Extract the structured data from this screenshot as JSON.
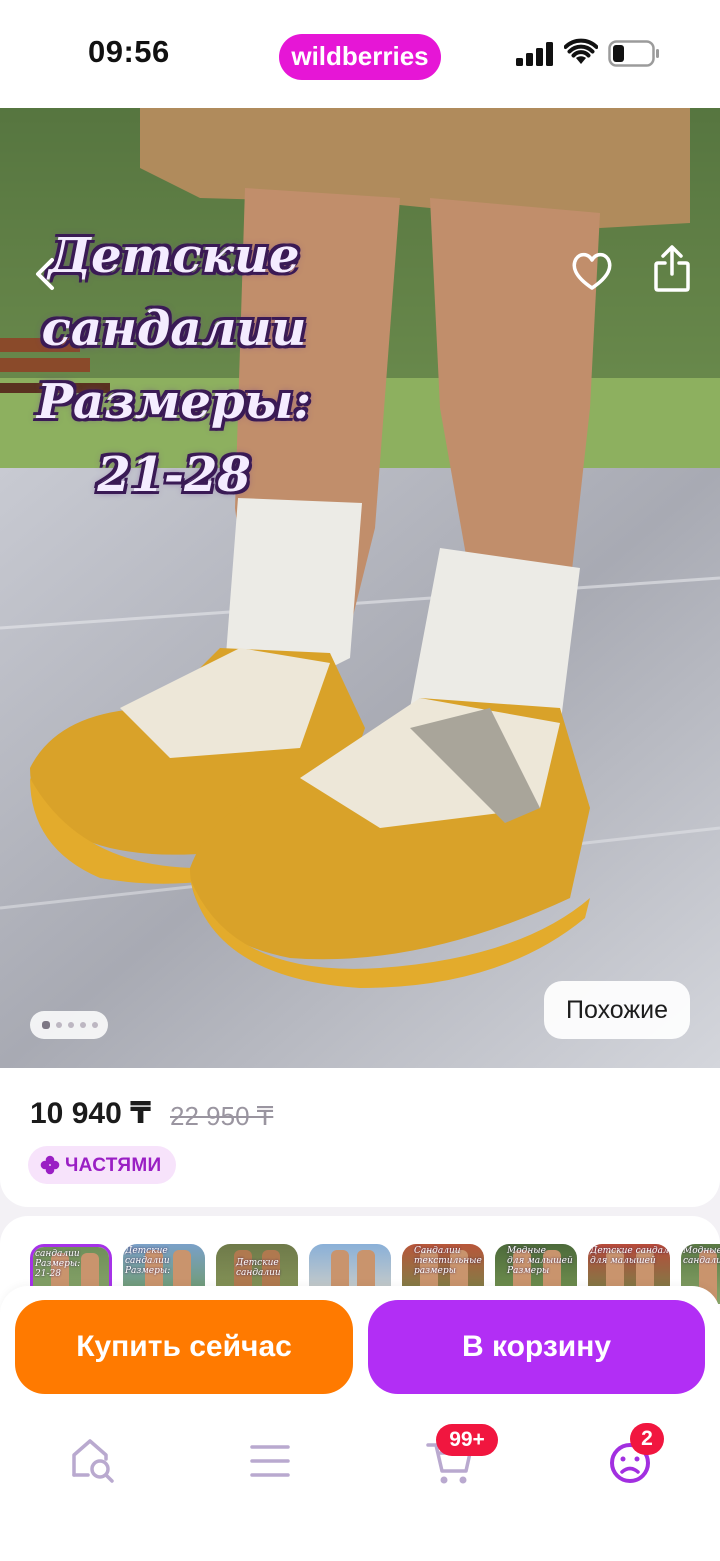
{
  "status_bar": {
    "time": "09:56",
    "brand": "wildberries",
    "icons": [
      "cellular-signal-icon",
      "wifi-icon",
      "battery-icon"
    ]
  },
  "product": {
    "image_caption_lines": [
      "Детские",
      "сандалии",
      "Размеры:",
      "21-28"
    ],
    "image_count": 5,
    "active_image": 1,
    "similar_label": "Похожие",
    "price_current": "10 940 ₸",
    "price_old": "22 950 ₸",
    "installments_label": "ЧАСТЯМИ"
  },
  "thumbnails": [
    {
      "caption": "сандалии\nРазмеры:\n21-28"
    },
    {
      "caption": "Детские\nсандалии\nРазмеры:"
    },
    {
      "caption": "Детские\nсандалии"
    },
    {
      "caption": ""
    },
    {
      "caption": "Сандалии\nтекстильные\nразмеры"
    },
    {
      "caption": "Модные\nдля малышей\nРазмеры"
    },
    {
      "caption": "Детские сандалии\nдля малышей"
    },
    {
      "caption": "Модные\nсандалии"
    }
  ],
  "actions": {
    "buy_now": "Купить сейчас",
    "add_to_cart": "В корзину"
  },
  "nav": {
    "items": [
      "home-search",
      "catalog",
      "cart",
      "profile"
    ],
    "cart_badge": "99+",
    "profile_badge": "2"
  },
  "colors": {
    "brand": "#e616d6",
    "buy_now": "#ff7a00",
    "add_to_cart": "#b22ef5",
    "badge": "#f1163f",
    "nav_icon": "#b9a9cf",
    "nav_active": "#a22fe0"
  }
}
